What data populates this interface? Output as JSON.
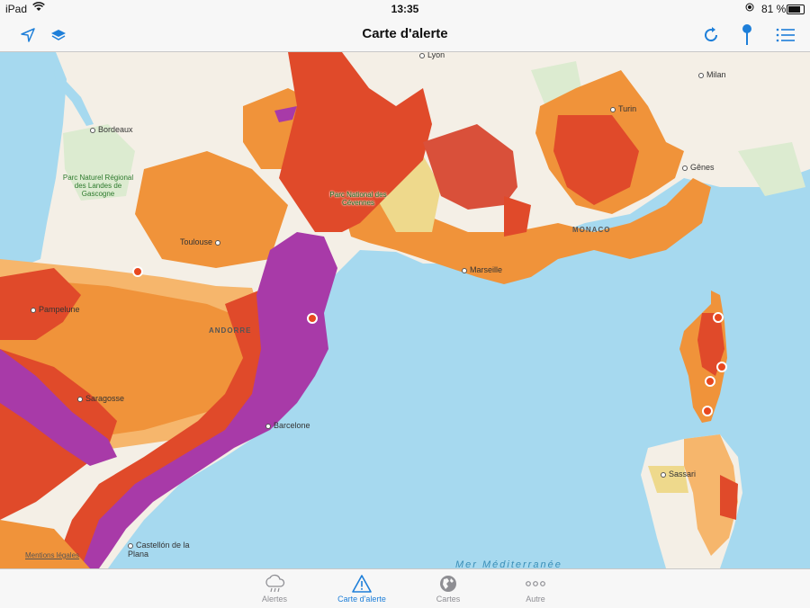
{
  "status": {
    "device": "iPad",
    "time": "13:35",
    "battery": "81 %"
  },
  "nav": {
    "title": "Carte d'alerte"
  },
  "map": {
    "cities": [
      "Lyon",
      "Milan",
      "Turin",
      "Bordeaux",
      "Toulouse",
      "Gênes",
      "Marseille",
      "Pampelune",
      "Saragosse",
      "Barcelone",
      "Sassari",
      "Castellón de la Plana"
    ],
    "countries": [
      "ANDORRE",
      "MONACO"
    ],
    "parks": [
      "Parc Naturel Régional des Landes de Gascogne",
      "Parc National des Cévennes"
    ],
    "sea": "Mer Méditerranée",
    "legal": "Mentions légales"
  },
  "tabs": [
    {
      "label": "Alertes",
      "icon": "cloud-rain-icon"
    },
    {
      "label": "Carte d'alerte",
      "icon": "warning-triangle-icon",
      "active": true
    },
    {
      "label": "Cartes",
      "icon": "globe-icon"
    },
    {
      "label": "Autre",
      "icon": "more-dots-icon"
    }
  ],
  "colors": {
    "accent": "#1e7fd9",
    "purple": "#a83aa8",
    "red": "#e04a2a",
    "orange": "#f0933a",
    "lightOrange": "#f6b66c",
    "yellow": "#eed98c",
    "sea": "#a6d9ef",
    "land": "#f4efe6"
  }
}
